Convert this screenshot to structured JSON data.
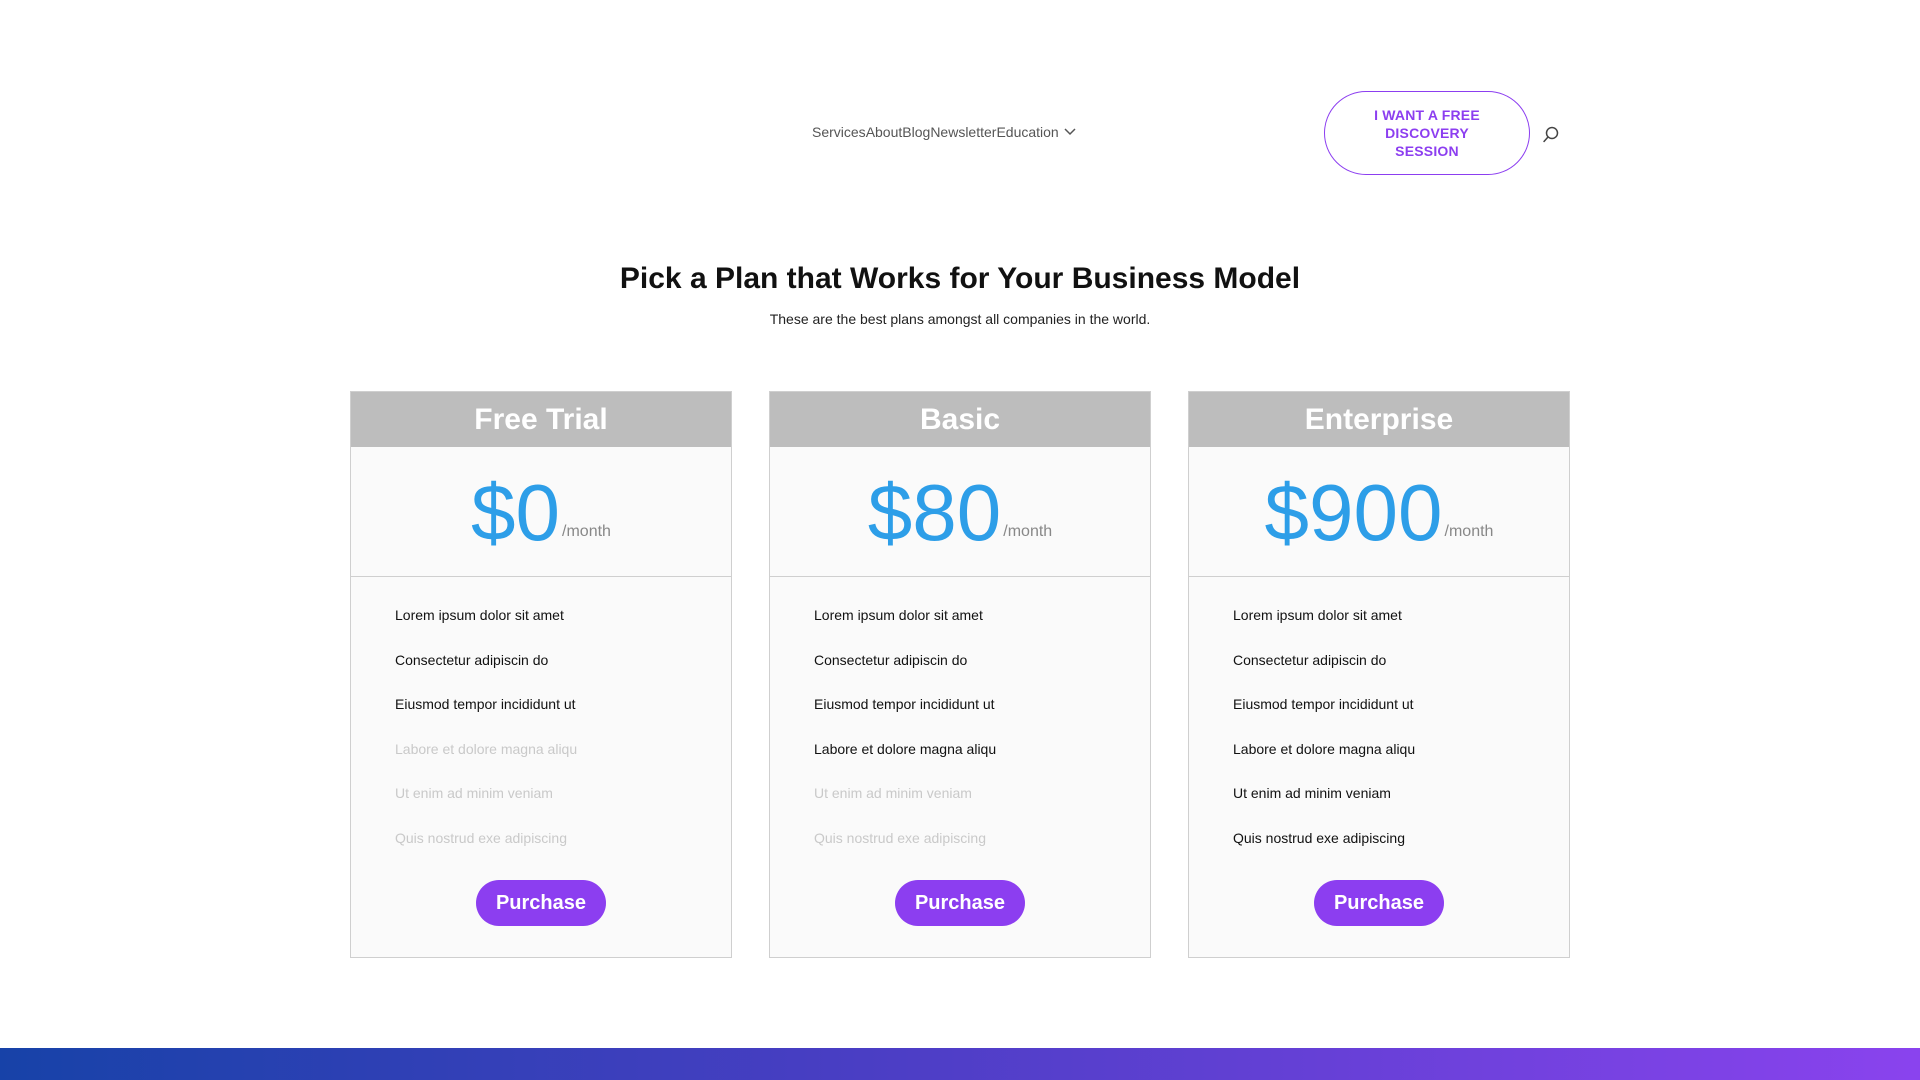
{
  "nav": {
    "items": [
      "Services",
      "About",
      "Blog",
      "Newsletter",
      "Education"
    ],
    "dropdown_icon": "chevron-down-icon"
  },
  "cta": {
    "label": "I WANT A FREE DISCOVERY SESSION",
    "color": "#8c3ef0"
  },
  "search": {
    "icon": "search-icon"
  },
  "section": {
    "title": "Pick a Plan that Works for Your Business Model",
    "subtitle": "These are the best plans amongst all companies in the world."
  },
  "plans": [
    {
      "name": "Free Trial",
      "price": "$0",
      "period": "/month",
      "features": [
        {
          "text": "Lorem ipsum dolor sit amet",
          "enabled": true
        },
        {
          "text": "Consectetur adipiscin do",
          "enabled": true
        },
        {
          "text": "Eiusmod tempor incididunt ut",
          "enabled": true
        },
        {
          "text": "Labore et dolore magna aliqu",
          "enabled": false
        },
        {
          "text": "Ut enim ad minim veniam",
          "enabled": false
        },
        {
          "text": "Quis nostrud exe adipiscing",
          "enabled": false
        }
      ],
      "button": "Purchase"
    },
    {
      "name": "Basic",
      "price": "$80",
      "period": "/month",
      "features": [
        {
          "text": "Lorem ipsum dolor sit amet",
          "enabled": true
        },
        {
          "text": "Consectetur adipiscin do",
          "enabled": true
        },
        {
          "text": "Eiusmod tempor incididunt ut",
          "enabled": true
        },
        {
          "text": "Labore et dolore magna aliqu",
          "enabled": true
        },
        {
          "text": "Ut enim ad minim veniam",
          "enabled": false
        },
        {
          "text": "Quis nostrud exe adipiscing",
          "enabled": false
        }
      ],
      "button": "Purchase"
    },
    {
      "name": "Enterprise",
      "price": "$900",
      "period": "/month",
      "features": [
        {
          "text": "Lorem ipsum dolor sit amet",
          "enabled": true
        },
        {
          "text": "Consectetur adipiscin do",
          "enabled": true
        },
        {
          "text": "Eiusmod tempor incididunt ut",
          "enabled": true
        },
        {
          "text": "Labore et dolore magna aliqu",
          "enabled": true
        },
        {
          "text": "Ut enim ad minim veniam",
          "enabled": true
        },
        {
          "text": "Quis nostrud exe adipiscing",
          "enabled": true
        }
      ],
      "button": "Purchase"
    }
  ],
  "colors": {
    "accent": "#8c3ef0",
    "price": "#2d9ee8",
    "card_header": "#bdbdbd",
    "disabled_text": "#c9c9c9"
  }
}
